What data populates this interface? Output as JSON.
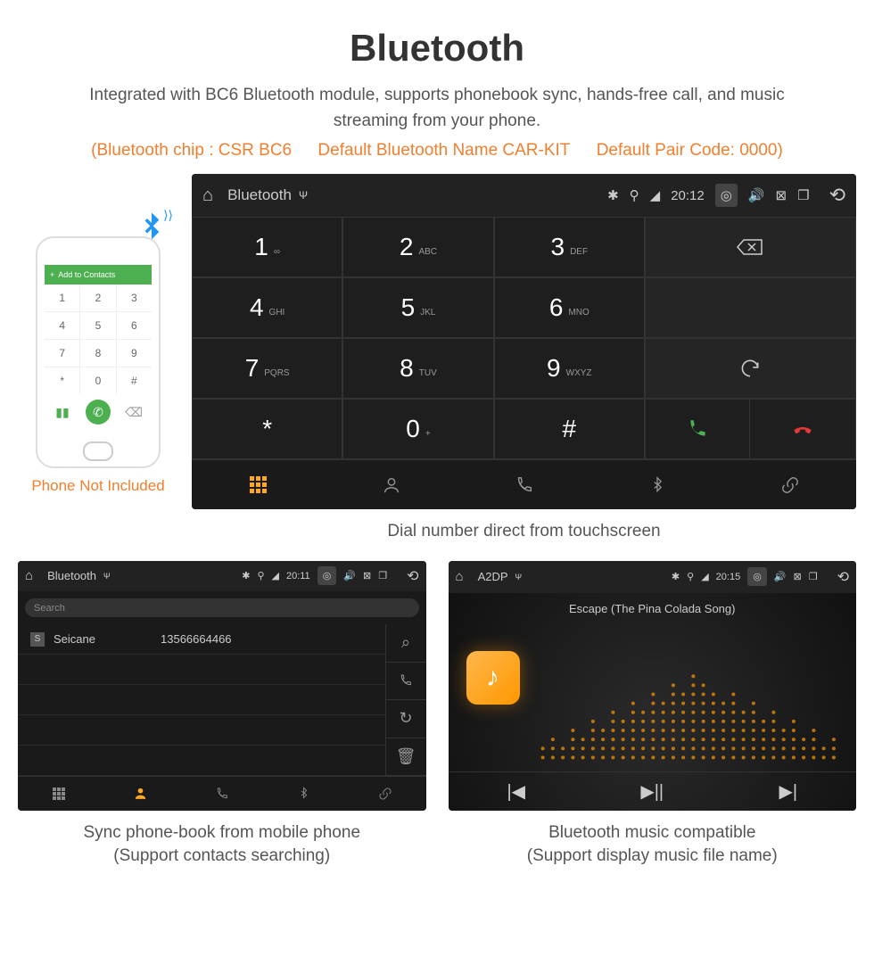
{
  "header": {
    "title": "Bluetooth",
    "desc": "Integrated with BC6 Bluetooth module, supports phonebook sync, hands-free call, and music streaming from your phone.",
    "spec1": "(Bluetooth chip : CSR BC6",
    "spec2": "Default Bluetooth Name CAR-KIT",
    "spec3": "Default Pair Code: 0000)"
  },
  "phone": {
    "bar": "Add to Contacts",
    "caption": "Phone Not Included",
    "keys": [
      "1",
      "2",
      "3",
      "4",
      "5",
      "6",
      "7",
      "8",
      "9",
      "*",
      "0",
      "#"
    ]
  },
  "mainScreen": {
    "title": "Bluetooth",
    "time": "20:12",
    "keys": [
      {
        "n": "1",
        "s": "∞"
      },
      {
        "n": "2",
        "s": "ABC"
      },
      {
        "n": "3",
        "s": "DEF"
      },
      {
        "n": "4",
        "s": "GHI"
      },
      {
        "n": "5",
        "s": "JKL"
      },
      {
        "n": "6",
        "s": "MNO"
      },
      {
        "n": "7",
        "s": "PQRS"
      },
      {
        "n": "8",
        "s": "TUV"
      },
      {
        "n": "9",
        "s": "WXYZ"
      },
      {
        "n": "*",
        "s": ""
      },
      {
        "n": "0",
        "s": "+"
      },
      {
        "n": "#",
        "s": ""
      }
    ],
    "caption": "Dial number direct from touchscreen"
  },
  "phonebook": {
    "title": "Bluetooth",
    "time": "20:11",
    "search": "Search",
    "tag": "S",
    "name": "Seicane",
    "number": "13566664466",
    "caption1": "Sync phone-book from mobile phone",
    "caption2": "(Support contacts searching)"
  },
  "music": {
    "title": "A2DP",
    "time": "20:15",
    "song": "Escape (The Pina Colada Song)",
    "caption1": "Bluetooth music compatible",
    "caption2": "(Support display music file name)"
  }
}
